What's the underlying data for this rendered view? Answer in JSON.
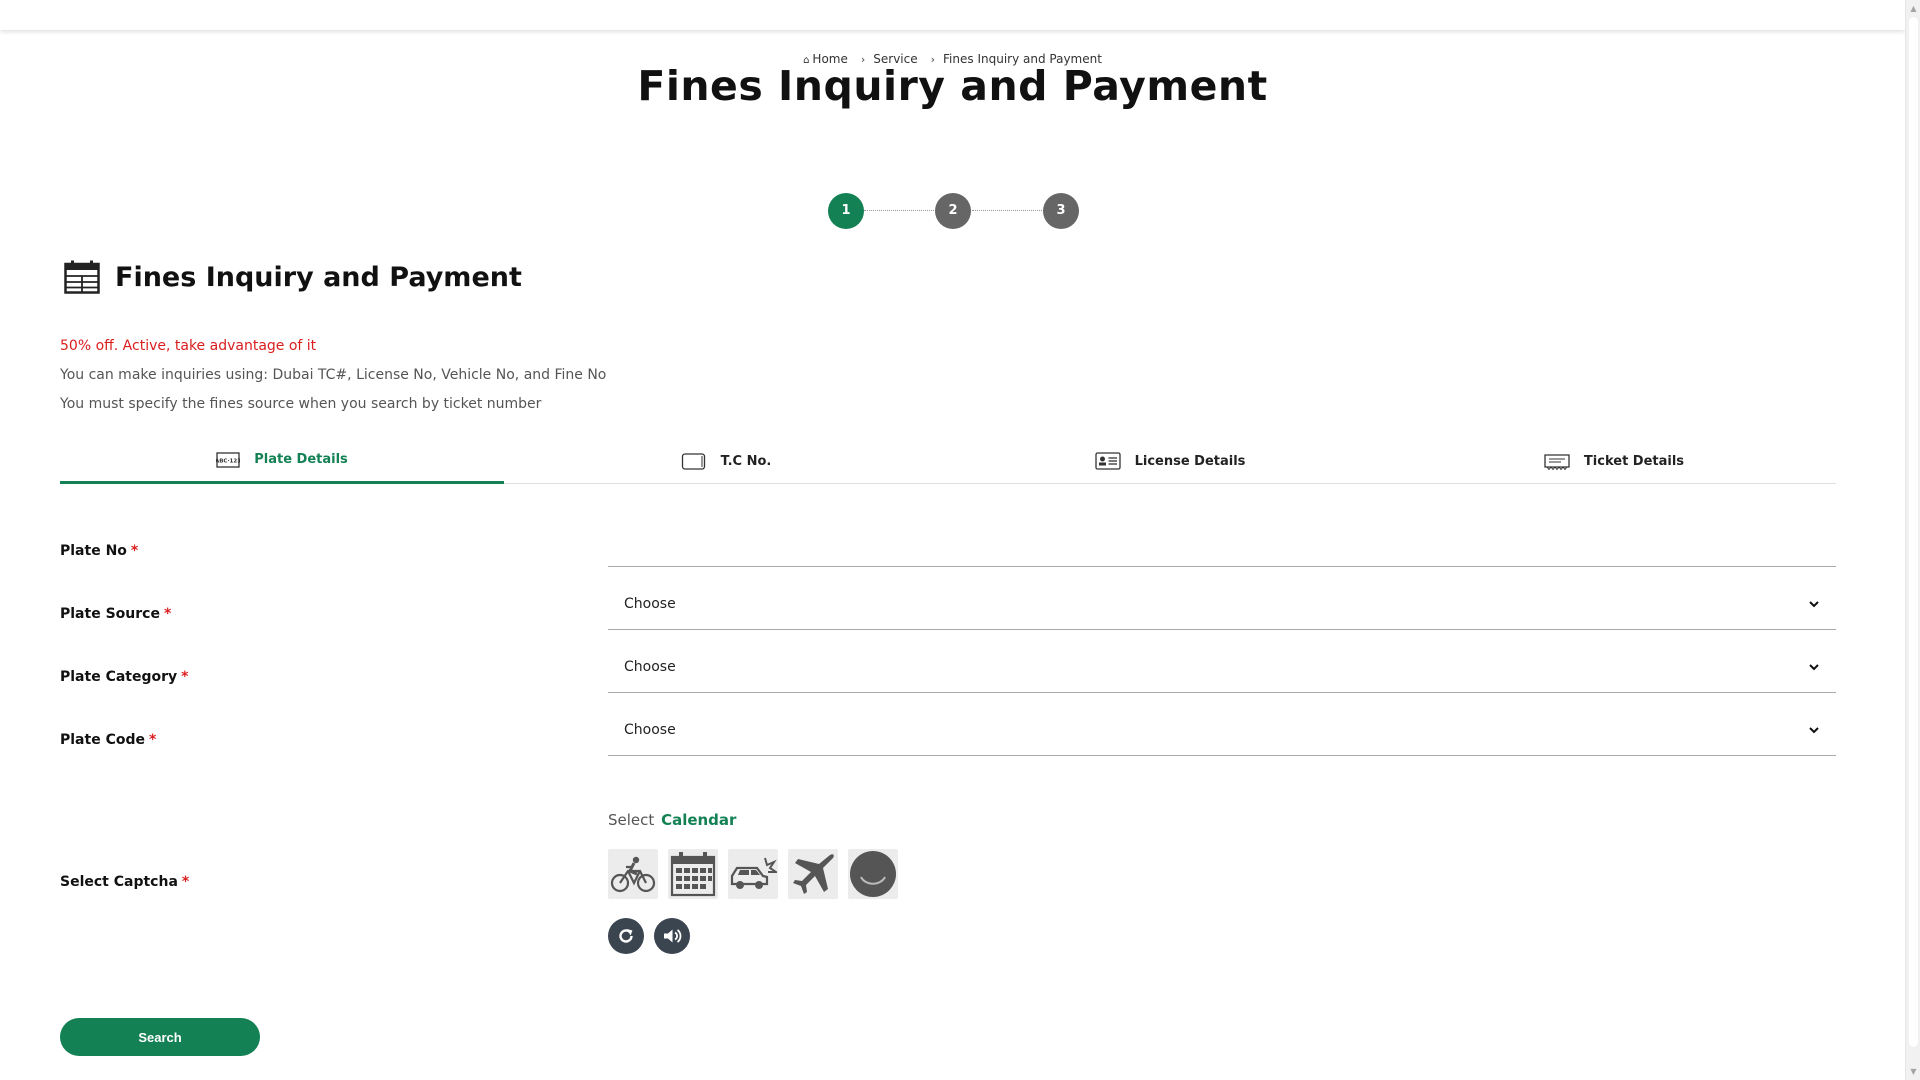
{
  "breadcrumb": {
    "home": "Home",
    "service": "Service",
    "current": "Fines Inquiry and Payment"
  },
  "page_title": "Fines Inquiry and Payment",
  "stepper": {
    "steps": [
      "1",
      "2",
      "3"
    ],
    "active_step": 1
  },
  "section": {
    "title": "Fines Inquiry and Payment",
    "icon": "calendar-icon"
  },
  "info": {
    "promo": "50% off. Active, take advantage of it",
    "line2": "You can make inquiries using: Dubai TC#, License No, Vehicle No, and Fine No",
    "line3": "You must specify the fines source when you search by ticket number"
  },
  "tabs": [
    {
      "label": "Plate Details",
      "icon": "plate-icon",
      "active": true
    },
    {
      "label": "T.C No.",
      "icon": "card-icon",
      "active": false
    },
    {
      "label": "License Details",
      "icon": "license-icon",
      "active": false
    },
    {
      "label": "Ticket Details",
      "icon": "ticket-icon",
      "active": false
    }
  ],
  "form": {
    "plate_no": {
      "label": "Plate No",
      "required_mark": "*",
      "value": ""
    },
    "plate_source": {
      "label": "Plate Source",
      "required_mark": "*",
      "value": "Choose"
    },
    "plate_category": {
      "label": "Plate Category",
      "required_mark": "*",
      "value": "Choose"
    },
    "plate_code": {
      "label": "Plate Code",
      "required_mark": "*",
      "value": "Choose"
    }
  },
  "captcha": {
    "label": "Select Captcha",
    "required_mark": "*",
    "prompt_prefix": "Select",
    "target": "Calendar",
    "options": [
      "bicycle-icon",
      "calendar-icon",
      "car-crash-icon",
      "airplane-icon",
      "circle-icon"
    ],
    "refresh_icon": "refresh-icon",
    "audio_icon": "speaker-icon"
  },
  "search_button": "Search",
  "colors": {
    "accent": "#138153",
    "required": "#d91e1e",
    "step_inactive": "#666666"
  }
}
